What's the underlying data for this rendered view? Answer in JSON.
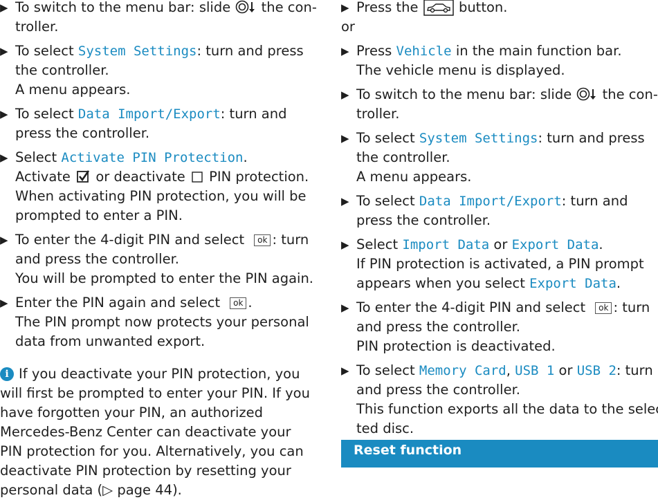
{
  "left": {
    "step1": {
      "pre": "To switch to the menu bar: slide",
      "post": "the con-",
      "line2": "troller."
    },
    "step2": {
      "pre": "To select",
      "term": "System Settings",
      "post": ": turn and press",
      "line2": "the controller.",
      "line3": "A menu appears."
    },
    "step3": {
      "pre": "To select",
      "term": "Data Import/Export",
      "post": ": turn and",
      "line2": "press the controller."
    },
    "step4": {
      "pre": "Select",
      "term": "Activate PIN Protection",
      "post": ".",
      "l2_pre": "Activate",
      "l2_mid": "or deactivate",
      "l2_post": "PIN protection.",
      "line3": "When activating PIN protection, you will be",
      "line4": "prompted to enter a PIN."
    },
    "step5": {
      "pre": "To enter the 4-digit PIN and select",
      "ok": "ok",
      "post": ": turn",
      "line2": "and press the controller.",
      "line3": "You will be prompted to enter the PIN again."
    },
    "step6": {
      "pre": "Enter the PIN again and select",
      "ok": "ok",
      "post": ".",
      "line2": "The PIN prompt now protects your personal",
      "line3": "data from unwanted export."
    },
    "info": {
      "lines": [
        "If you deactivate your PIN protection, you",
        "will first be prompted to enter your PIN. If you",
        "have forgotten your PIN, an authorized",
        "Mercedes-Benz Center can deactivate your",
        "PIN protection for you. Alternatively, you can",
        "deactivate PIN protection by resetting your"
      ],
      "last_pre": "personal data (",
      "page_ref": "▷ page 44",
      "last_post": ")."
    }
  },
  "right": {
    "step1": {
      "pre": "Press the",
      "post": "button."
    },
    "or": "or",
    "step2": {
      "pre": "Press",
      "term": "Vehicle",
      "post": "in the main function bar.",
      "line2": "The vehicle menu is displayed."
    },
    "step3": {
      "pre": "To switch to the menu bar: slide",
      "post": "the con-",
      "line2": "troller."
    },
    "step4": {
      "pre": "To select",
      "term": "System Settings",
      "post": ": turn and press",
      "line2": "the controller.",
      "line3": "A menu appears."
    },
    "step5": {
      "pre": "To select",
      "term": "Data Import/Export",
      "post": ": turn and",
      "line2": "press the controller."
    },
    "step6": {
      "pre": "Select",
      "term1": "Import Data",
      "mid": "or",
      "term2": "Export Data",
      "post": ".",
      "line2": "If PIN protection is activated, a PIN prompt",
      "l3_pre": "appears when you select",
      "l3_term": "Export Data",
      "l3_post": "."
    },
    "step7": {
      "pre": "To enter the 4-digit PIN and select",
      "ok": "ok",
      "post": ": turn",
      "line2": "and press the controller.",
      "line3": "PIN protection is deactivated."
    },
    "step8": {
      "pre": "To select",
      "term1": "Memory Card",
      "sep": ",",
      "term2": "USB 1",
      "mid": "or",
      "term3": "USB 2",
      "post": ": turn",
      "line2": "and press the controller.",
      "line3": "This function exports all the data to the selec-",
      "line4": "ted disc."
    }
  },
  "section_header": "Reset function",
  "colors": {
    "accent": "#1a8bc1",
    "text": "#1f1f1f"
  },
  "icons": {
    "step_marker": "triangle-right-icon",
    "controller": "controller-slide-down-icon",
    "checkbox_checked": "checkbox-checked-icon",
    "checkbox_empty": "checkbox-empty-icon",
    "vehicle_button": "car-button-icon",
    "info": "info-icon"
  }
}
